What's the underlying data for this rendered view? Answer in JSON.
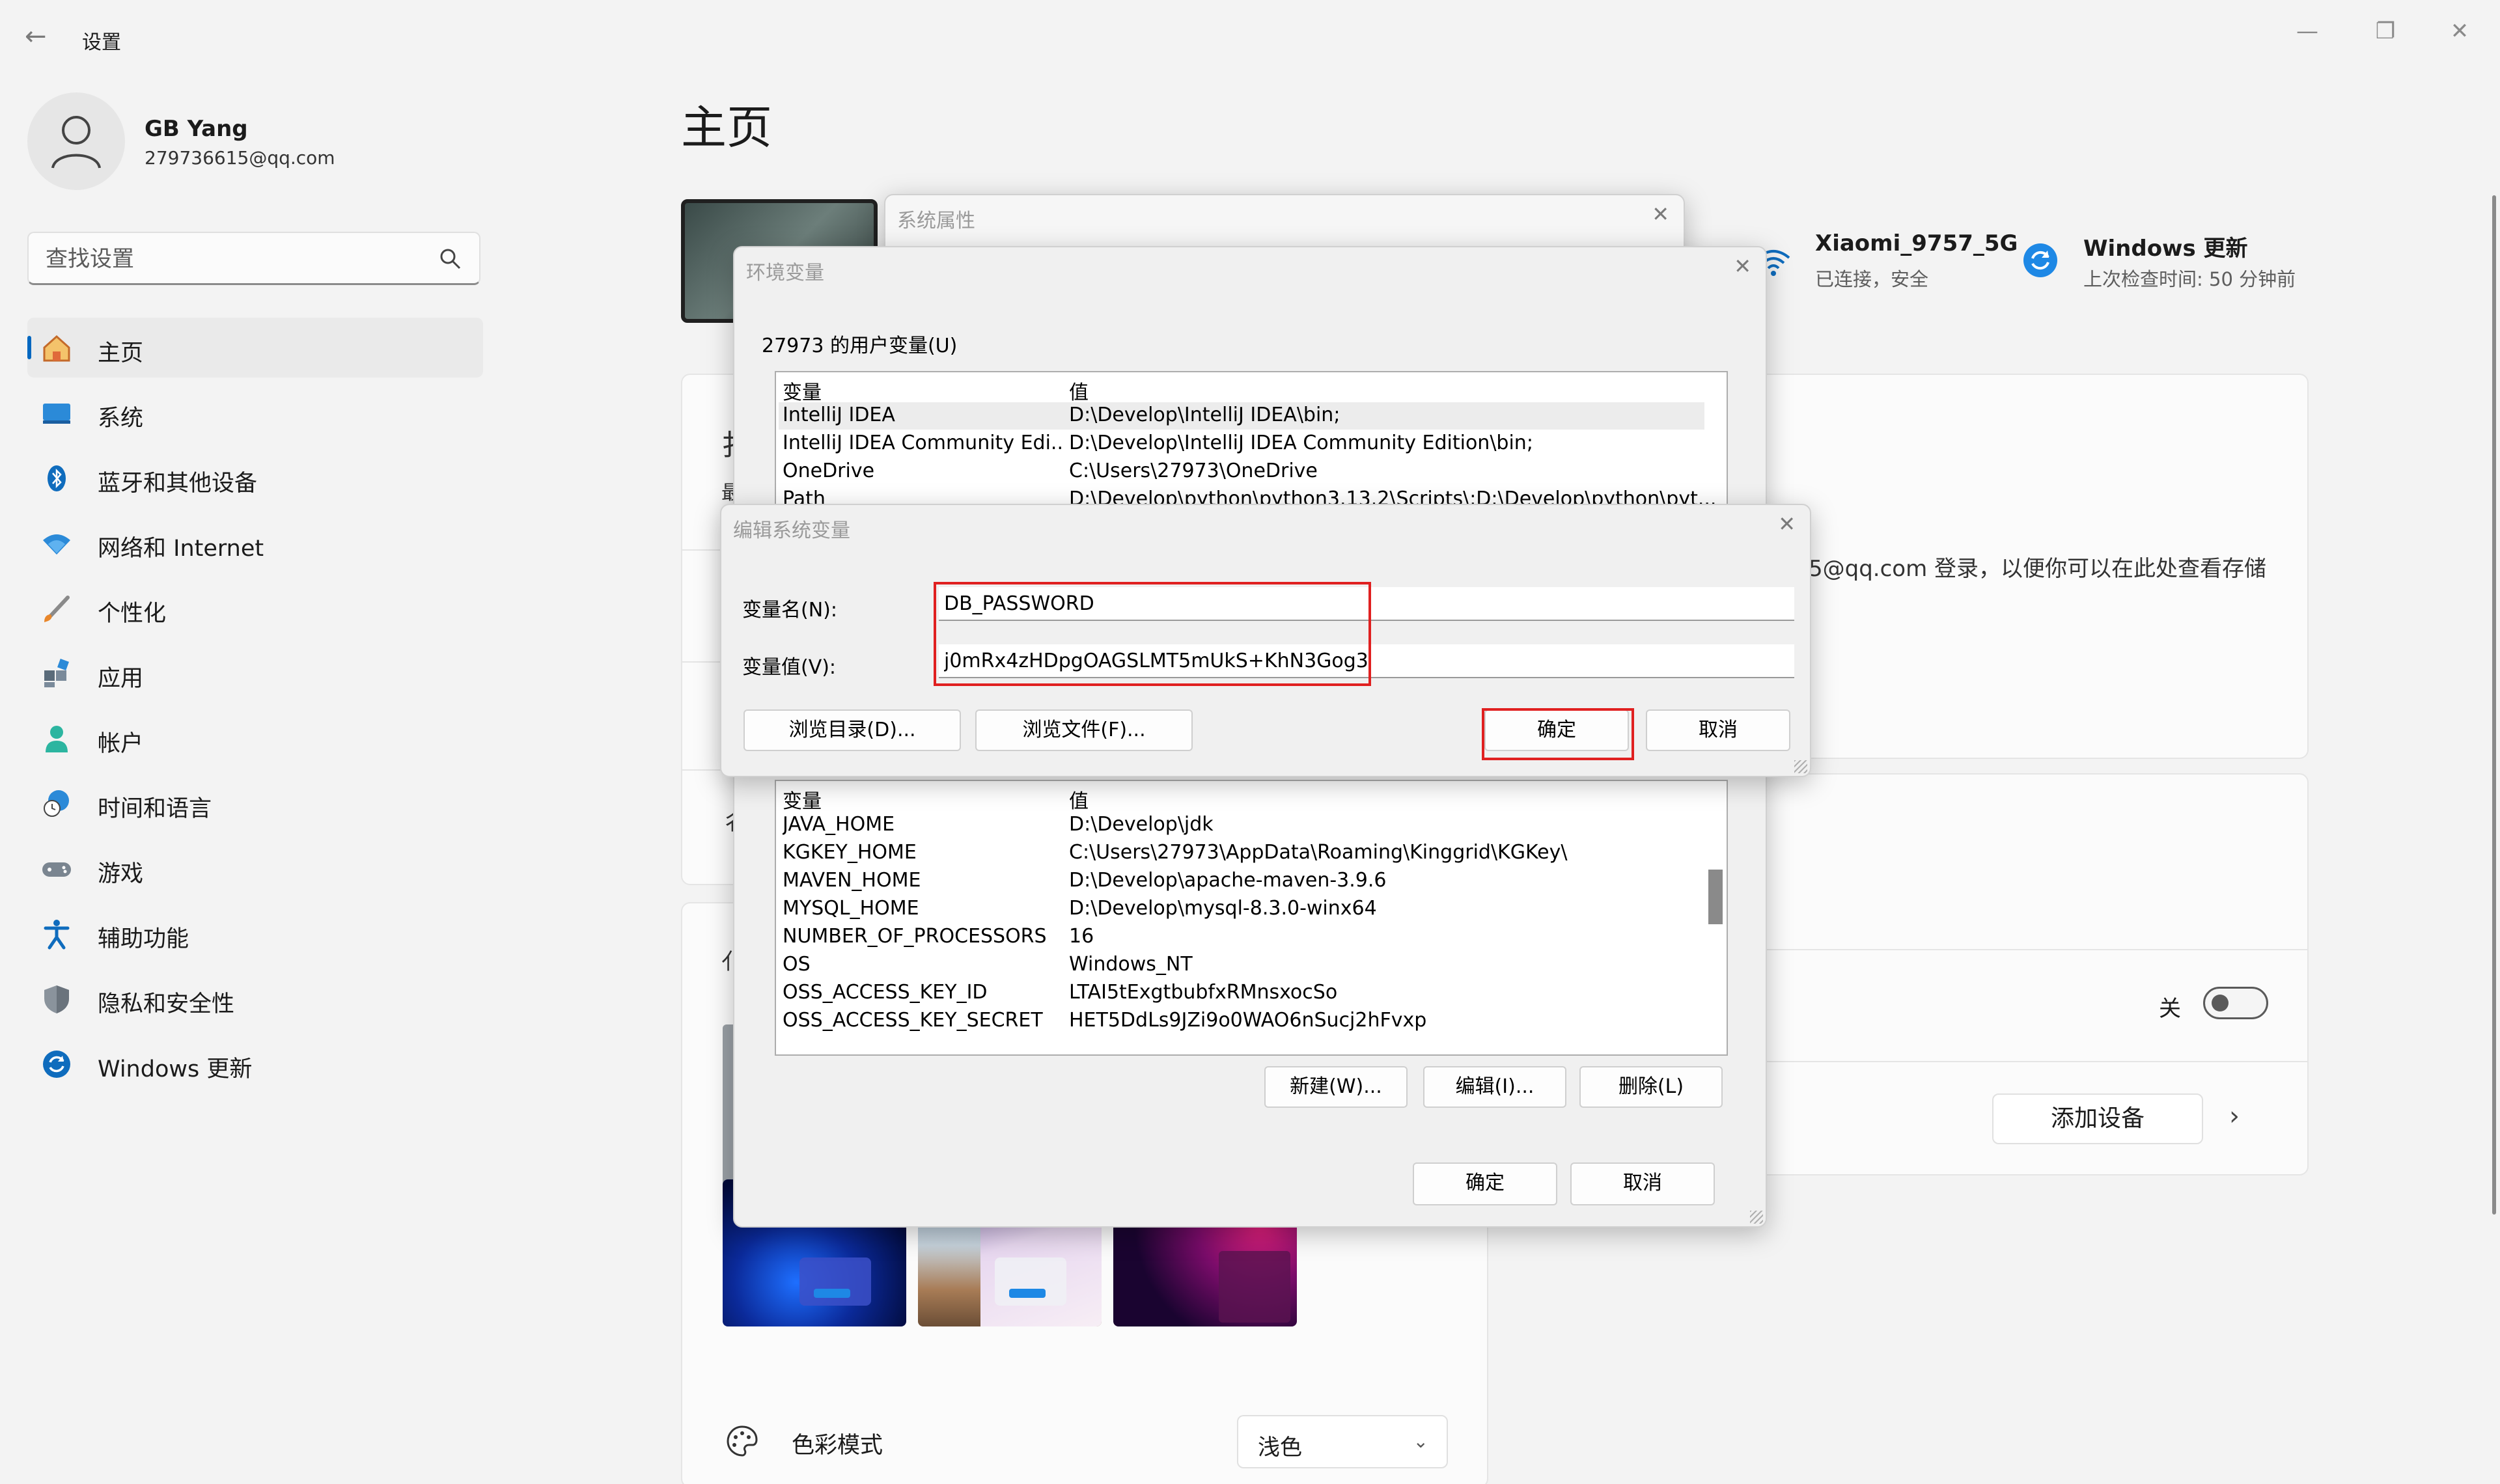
{
  "app": {
    "title": "设置"
  },
  "window_controls": [
    "minimize",
    "maximize",
    "close"
  ],
  "profile": {
    "name": "GB Yang",
    "email": "279736615@qq.com"
  },
  "search": {
    "placeholder": "查找设置"
  },
  "nav": {
    "items": [
      {
        "label": "主页",
        "icon": "home-icon",
        "active": true
      },
      {
        "label": "系统",
        "icon": "system-icon"
      },
      {
        "label": "蓝牙和其他设备",
        "icon": "bluetooth-icon"
      },
      {
        "label": "网络和 Internet",
        "icon": "wifi-icon"
      },
      {
        "label": "个性化",
        "icon": "brush-icon"
      },
      {
        "label": "应用",
        "icon": "apps-icon"
      },
      {
        "label": "帐户",
        "icon": "account-icon"
      },
      {
        "label": "时间和语言",
        "icon": "clock-globe-icon"
      },
      {
        "label": "游戏",
        "icon": "gamepad-icon"
      },
      {
        "label": "辅助功能",
        "icon": "accessibility-icon"
      },
      {
        "label": "隐私和安全性",
        "icon": "shield-icon"
      },
      {
        "label": "Windows 更新",
        "icon": "update-icon"
      }
    ]
  },
  "main": {
    "title": "主页",
    "network": {
      "name": "Xiaomi_9757_5G",
      "status": "已连接，安全"
    },
    "update": {
      "title": "Windows 更新",
      "status": "上次检查时间: 50 分钟前"
    },
    "onedrive_text": "5@qq.com 登录，以便你可以在此处查看存储",
    "partial_chars": {
      "a": "扌",
      "b": "最",
      "c": "亻",
      "d": "彳"
    },
    "toggle": {
      "label": "关",
      "on": false
    },
    "add_device": "添加设备",
    "color_mode": {
      "label": "色彩模式",
      "value": "浅色"
    }
  },
  "system_props": {
    "title": "系统属性"
  },
  "env_dialog": {
    "title": "环境变量",
    "user_section": "27973 的用户变量(U)",
    "columns": [
      "变量",
      "值"
    ],
    "user_vars": [
      {
        "name": "IntelliJ IDEA",
        "value": "D:\\Develop\\IntelliJ IDEA\\bin;"
      },
      {
        "name": "IntelliJ IDEA Community Edi...",
        "value": "D:\\Develop\\IntelliJ IDEA Community Edition\\bin;"
      },
      {
        "name": "OneDrive",
        "value": "C:\\Users\\27973\\OneDrive"
      },
      {
        "name": "Path",
        "value": "D:\\Develop\\python\\python3.13.2\\Scripts\\;D:\\Develop\\python\\pyt..."
      }
    ],
    "system_vars": [
      {
        "name": "JAVA_HOME",
        "value": "D:\\Develop\\jdk"
      },
      {
        "name": "KGKEY_HOME",
        "value": "C:\\Users\\27973\\AppData\\Roaming\\Kinggrid\\KGKey\\"
      },
      {
        "name": "MAVEN_HOME",
        "value": "D:\\Develop\\apache-maven-3.9.6"
      },
      {
        "name": "MYSQL_HOME",
        "value": "D:\\Develop\\mysql-8.3.0-winx64"
      },
      {
        "name": "NUMBER_OF_PROCESSORS",
        "value": "16"
      },
      {
        "name": "OS",
        "value": "Windows_NT"
      },
      {
        "name": "OSS_ACCESS_KEY_ID",
        "value": "LTAI5tExgtbubfxRMnsxocSo"
      },
      {
        "name": "OSS_ACCESS_KEY_SECRET",
        "value": "HET5DdLs9JZi9o0WAO6nSucj2hFvxp"
      }
    ],
    "buttons": {
      "new": "新建(W)...",
      "edit": "编辑(I)...",
      "delete": "删除(L)",
      "ok": "确定",
      "cancel": "取消"
    }
  },
  "edit_dialog": {
    "title": "编辑系统变量",
    "name_label": "变量名(N):",
    "value_label": "变量值(V):",
    "name_value": "DB_PASSWORD",
    "value_value": "j0mRx4zHDpgOAGSLMT5mUkS+KhN3Gog3",
    "buttons": {
      "browse_dir": "浏览目录(D)...",
      "browse_file": "浏览文件(F)...",
      "ok": "确定",
      "cancel": "取消"
    }
  },
  "colors": {
    "accent": "#0067c0",
    "highlight": "#e02020"
  }
}
